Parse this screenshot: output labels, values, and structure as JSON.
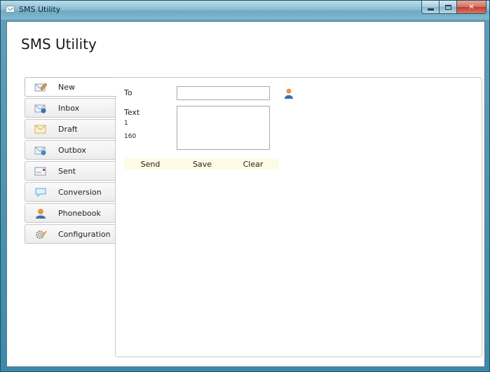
{
  "window": {
    "title": "SMS Utility"
  },
  "app": {
    "heading": "SMS Utility"
  },
  "sidebar": {
    "items": [
      {
        "label": "New",
        "icon": "new-message-icon"
      },
      {
        "label": "Inbox",
        "icon": "inbox-icon"
      },
      {
        "label": "Draft",
        "icon": "draft-icon"
      },
      {
        "label": "Outbox",
        "icon": "outbox-icon"
      },
      {
        "label": "Sent",
        "icon": "sent-icon"
      },
      {
        "label": "Conversion",
        "icon": "conversion-icon"
      },
      {
        "label": "Phonebook",
        "icon": "phonebook-icon"
      },
      {
        "label": "Configuration",
        "icon": "configuration-icon"
      }
    ],
    "active": "New"
  },
  "compose": {
    "to_label": "To",
    "to_value": "",
    "text_label": "Text",
    "text_value": "",
    "counter_parts": "1",
    "counter_remaining": "160",
    "send_label": "Send",
    "save_label": "Save",
    "clear_label": "Clear"
  },
  "colors": {
    "button_bg": "#fdfbe3",
    "panel_border": "#c9c9c9",
    "accent_blue": "#3a6fb0",
    "contact_orange": "#e8944a"
  }
}
